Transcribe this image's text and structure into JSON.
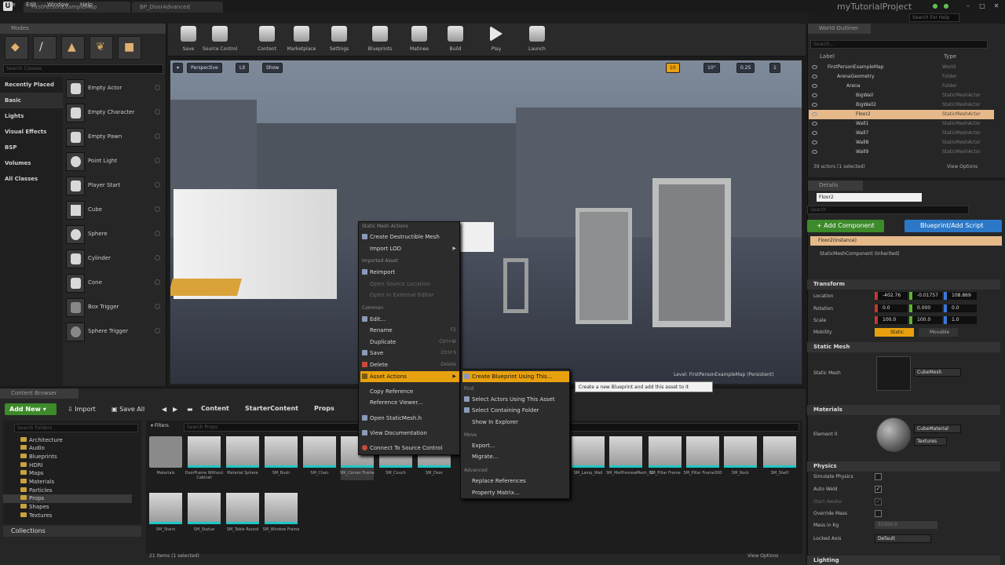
{
  "window": {
    "tabs": [
      "FirstPersonExampleMap",
      "BP_DoorAdvanced"
    ],
    "project_name": "myTutorialProject",
    "help_search_placeholder": "Search For Help"
  },
  "menubar": [
    "File",
    "Edit",
    "Window",
    "Help"
  ],
  "modes": {
    "tab_label": "Modes",
    "search_placeholder": "Search Classes",
    "categories": [
      "Recently Placed",
      "Basic",
      "Lights",
      "Visual Effects",
      "BSP",
      "Volumes",
      "All Classes"
    ],
    "actors": [
      "Empty Actor",
      "Empty Character",
      "Empty Pawn",
      "Point Light",
      "Player Start",
      "Cube",
      "Sphere",
      "Cylinder",
      "Cone",
      "Box Trigger",
      "Sphere Trigger"
    ]
  },
  "toolbar": [
    "Save",
    "Source Control",
    "Content",
    "Marketplace",
    "Settings",
    "Blueprints",
    "Matinee",
    "Build",
    "Play",
    "Launch"
  ],
  "viewport": {
    "view_mode": "Perspective",
    "lit": "Lit",
    "show": "Show",
    "grid_size": "10",
    "rotation_snap": "10°",
    "scale_snap": "0.25",
    "camera_speed": "1",
    "level_label": "Level: FirstPersonExampleMap (Persistent)"
  },
  "context_menu": {
    "sections": [
      {
        "header": "Static Mesh Actions",
        "items": [
          {
            "label": "Create Destructible Mesh",
            "shortcut": "",
            "disabled": false
          },
          {
            "label": "Import LOD",
            "shortcut": "",
            "disabled": false,
            "submenu": true
          }
        ]
      },
      {
        "header": "Imported Asset",
        "items": [
          {
            "label": "Reimport",
            "shortcut": "",
            "disabled": false
          },
          {
            "label": "Open Source Location",
            "shortcut": "",
            "disabled": true
          },
          {
            "label": "Open In External Editor",
            "shortcut": "",
            "disabled": true
          }
        ]
      },
      {
        "header": "Common",
        "items": [
          {
            "label": "Edit...",
            "shortcut": "",
            "disabled": false
          },
          {
            "label": "Rename",
            "shortcut": "F2",
            "disabled": false
          },
          {
            "label": "Duplicate",
            "shortcut": "Ctrl+W",
            "disabled": false
          },
          {
            "label": "Save",
            "shortcut": "Ctrl+S",
            "disabled": false
          },
          {
            "label": "Delete",
            "shortcut": "Delete",
            "disabled": false
          },
          {
            "label": "Asset Actions",
            "shortcut": "",
            "disabled": false,
            "submenu": true,
            "highlight": true
          },
          {
            "label": "Copy Reference",
            "shortcut": "",
            "disabled": false
          },
          {
            "label": "Reference Viewer...",
            "shortcut": "",
            "disabled": false
          },
          {
            "label": "Open StaticMesh.h",
            "shortcut": "",
            "disabled": false
          },
          {
            "label": "View Documentation",
            "shortcut": "",
            "disabled": false
          },
          {
            "label": "Connect To Source Control",
            "shortcut": "",
            "disabled": false
          }
        ]
      }
    ],
    "submenu": {
      "items": [
        "Create Blueprint Using This...",
        "Select Actors Using This Asset",
        "Select Containing Folder",
        "Show In Explorer",
        "Export...",
        "Migrate...",
        "Replace References",
        "Property Matrix..."
      ],
      "headers": [
        "Find",
        "Move",
        "Advanced"
      ]
    },
    "tooltip": "Create a new Blueprint and add this asset to it"
  },
  "content_browser": {
    "tab_label": "Content Browser",
    "add_new": "Add New",
    "import": "Import",
    "save_all": "Save All",
    "breadcrumb": [
      "Content",
      "StarterContent",
      "Props"
    ],
    "search_folders": "Search Folders",
    "folders": [
      "Architecture",
      "Audio",
      "Blueprints",
      "HDRI",
      "Maps",
      "Materials",
      "Particles",
      "Props",
      "Shapes",
      "Textures"
    ],
    "collections": "Collections",
    "filters": "Filters",
    "search_placeholder": "Search Props",
    "assets": [
      "Materials",
      "DoorFrame Without Cabinet",
      "Material Sphere",
      "SM_Bush",
      "SM_Chair",
      "SM_Corner Frame",
      "SM_Couch",
      "SM_Door",
      "SM_DoorFrame",
      "SM_Frame",
      "SM_GlassWindow",
      "SM_Lamp_Ceiling",
      "SM_Lamp_Wall",
      "SM_MatPreviewMesh_02",
      "SM_Pillar Frame",
      "SM_Pillar Frame300",
      "SM_Rock",
      "SM_Shelf",
      "SM_Stairs",
      "SM_Statue",
      "SM_Table Round",
      "SM_Window Frame"
    ],
    "item_count": "21 items (1 selected)",
    "view_options": "View Options"
  },
  "world_outliner": {
    "tab_label": "World Outliner",
    "search_placeholder": "Search...",
    "col_label": "Label",
    "col_type": "Type",
    "rows": [
      {
        "name": "FirstPersonExampleMap",
        "type": "World",
        "indent": 0
      },
      {
        "name": "ArenaGeometry",
        "type": "Folder",
        "indent": 1
      },
      {
        "name": "Arena",
        "type": "Folder",
        "indent": 2
      },
      {
        "name": "BigWall",
        "type": "StaticMeshActor",
        "indent": 3
      },
      {
        "name": "BigWall2",
        "type": "StaticMeshActor",
        "indent": 3
      },
      {
        "name": "Floor2",
        "type": "StaticMeshActor",
        "indent": 3,
        "selected": true
      },
      {
        "name": "Wall1",
        "type": "StaticMeshActor",
        "indent": 3
      },
      {
        "name": "Wall7",
        "type": "StaticMeshActor",
        "indent": 3
      },
      {
        "name": "Wall8",
        "type": "StaticMeshActor",
        "indent": 3
      },
      {
        "name": "Wall9",
        "type": "StaticMeshActor",
        "indent": 3
      }
    ],
    "count": "39 actors (1 selected)",
    "view_options": "View Options"
  },
  "details": {
    "tab_label": "Details",
    "name_value": "Floor2",
    "search_placeholder": "Search",
    "add_component": "+ Add Component",
    "blueprint_script": "Blueprint/Add Script",
    "instance_row": "Floor2(Instance)",
    "component_row": "StaticMeshComponent (Inherited)",
    "transform_header": "Transform",
    "location_label": "Location",
    "location": [
      "-402.76",
      "-0.01757",
      "108.869"
    ],
    "rotation_label": "Rotation",
    "rotation": [
      "0.0",
      "0.000",
      "0.0"
    ],
    "scale_label": "Scale",
    "scale": [
      "100.0",
      "100.0",
      "1.0"
    ],
    "mobility_label": "Mobility",
    "mobility_static": "Static",
    "mobility_movable": "Movable",
    "static_mesh_header": "Static Mesh",
    "static_mesh_label": "Static Mesh",
    "static_mesh_value": "CubeMesh",
    "materials_header": "Materials",
    "element_label": "Element 0",
    "material_value": "CubeMaterial",
    "textures": "Textures",
    "physics_header": "Physics",
    "physics_rows": [
      "Simulate Physics",
      "Auto Weld",
      "Start Awake",
      "Override Mass",
      "Mass in Kg",
      "Locked Axis"
    ],
    "mass_value": "55300.0",
    "locked_axis_value": "Default",
    "lighting_header": "Lighting"
  }
}
